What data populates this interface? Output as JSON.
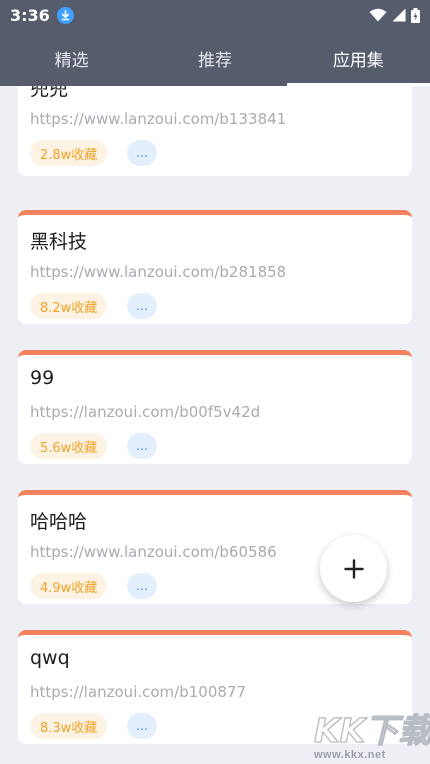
{
  "status_bar": {
    "time": "3:36",
    "icons": [
      "download-icon",
      "wifi-icon",
      "signal-icon",
      "battery-icon"
    ]
  },
  "tabs": [
    {
      "label": "精选",
      "active": false
    },
    {
      "label": "推荐",
      "active": false
    },
    {
      "label": "应用集",
      "active": true
    }
  ],
  "cards": [
    {
      "title": "兜兜",
      "url": "https://www.lanzoui.com/b133841",
      "favorites": "2.8w收藏",
      "more": "..."
    },
    {
      "title": "黑科技",
      "url": "https://www.lanzoui.com/b281858",
      "favorites": "8.2w收藏",
      "more": "..."
    },
    {
      "title": "99",
      "url": "https://lanzoui.com/b00f5v42d",
      "favorites": "5.6w收藏",
      "more": "..."
    },
    {
      "title": "哈哈哈",
      "url": "https://www.lanzoui.com/b60586",
      "favorites": "4.9w收藏",
      "more": "..."
    },
    {
      "title": "qwq",
      "url": "https://lanzoui.com/b100877",
      "favorites": "8.3w收藏",
      "more": "..."
    }
  ],
  "fab": {
    "icon": "plus-icon"
  },
  "watermark": {
    "logo_text": "KK下载",
    "url": "www.kkx.net"
  },
  "colors": {
    "header": "#565c6c",
    "accent_bar": "#f4825f",
    "favorites_text": "#f0a227",
    "favorites_bg": "#fdf3e4",
    "more_text": "#4e95ec",
    "more_bg": "#e4effd",
    "background": "#eeeff4"
  }
}
